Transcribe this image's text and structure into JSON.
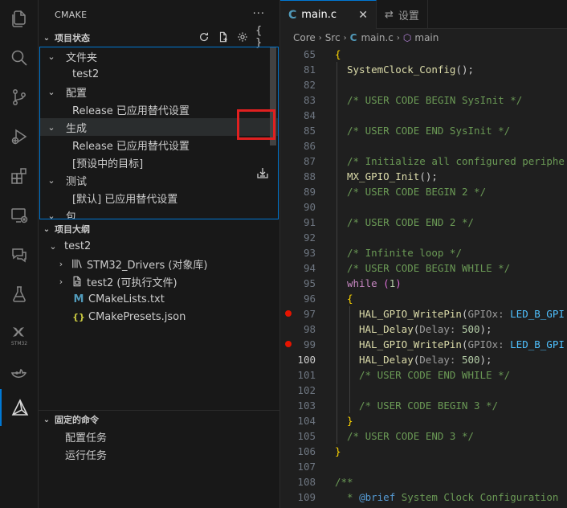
{
  "sidebar": {
    "title": "CMAKE",
    "more": "···",
    "project_status": {
      "title": "项目状态",
      "rows": [
        {
          "label": "文件夹",
          "kind": "group"
        },
        {
          "label": "test2",
          "kind": "leaf"
        },
        {
          "label": "配置",
          "kind": "group"
        },
        {
          "label": "Release  已应用替代设置",
          "kind": "leaf"
        },
        {
          "label": "生成",
          "kind": "group"
        },
        {
          "label": "Release  已应用替代设置",
          "kind": "leaf"
        },
        {
          "label": "[预设中的目标]",
          "kind": "leaf"
        },
        {
          "label": "测试",
          "kind": "group"
        },
        {
          "label": "[默认]  已应用替代设置",
          "kind": "leaf"
        },
        {
          "label": "包",
          "kind": "group"
        }
      ]
    },
    "project_outline": {
      "title": "项目大纲",
      "root": "test2",
      "items": [
        {
          "label": "STM32_Drivers (对象库)",
          "icon": "library-icon"
        },
        {
          "label": "test2 (可执行文件)",
          "icon": "executable-icon"
        },
        {
          "label": "CMakeLists.txt",
          "icon": "cmake-file-icon",
          "glyph": "M"
        },
        {
          "label": "CMakePresets.json",
          "icon": "json-file-icon",
          "glyph": "{}"
        }
      ]
    },
    "pinned_commands": {
      "title": "固定的命令",
      "items": [
        "配置任务",
        "运行任务"
      ]
    }
  },
  "activity_bar": {
    "items": [
      "explorer-icon",
      "search-icon",
      "source-control-icon",
      "run-debug-icon",
      "extensions-icon",
      "remote-explorer-icon",
      "chat-icon",
      "testing-icon",
      "stm32-icon",
      "docker-icon",
      "cmake-icon"
    ],
    "stm32_label": "STM32"
  },
  "editor": {
    "tabs": [
      {
        "label": "main.c",
        "icon": "C",
        "active": true
      },
      {
        "label": "设置",
        "icon": "settings-icon",
        "active": false
      }
    ],
    "breadcrumb": [
      "Core",
      "Src",
      "main.c",
      "main"
    ],
    "current_line": "100",
    "lines": [
      {
        "n": "65",
        "text": "{"
      },
      {
        "n": "81",
        "text": "SystemClock_Config();"
      },
      {
        "n": "82",
        "text": ""
      },
      {
        "n": "83",
        "text": "/* USER CODE BEGIN SysInit */"
      },
      {
        "n": "84",
        "text": ""
      },
      {
        "n": "85",
        "text": "/* USER CODE END SysInit */"
      },
      {
        "n": "86",
        "text": ""
      },
      {
        "n": "87",
        "text": "/* Initialize all configured periphe"
      },
      {
        "n": "88",
        "text": "MX_GPIO_Init();"
      },
      {
        "n": "89",
        "text": "/* USER CODE BEGIN 2 */"
      },
      {
        "n": "90",
        "text": ""
      },
      {
        "n": "91",
        "text": "/* USER CODE END 2 */"
      },
      {
        "n": "92",
        "text": ""
      },
      {
        "n": "93",
        "text": "/* Infinite loop */"
      },
      {
        "n": "94",
        "text": "/* USER CODE BEGIN WHILE */"
      },
      {
        "n": "95",
        "text": "while (1)"
      },
      {
        "n": "96",
        "text": "{"
      },
      {
        "n": "97",
        "text": "HAL_GPIO_WritePin(GPIOx: LED_B_GPI"
      },
      {
        "n": "98",
        "text": "HAL_Delay(Delay: 500);"
      },
      {
        "n": "99",
        "text": "HAL_GPIO_WritePin(GPIOx: LED_B_GPI"
      },
      {
        "n": "100",
        "text": "HAL_Delay(Delay: 500);"
      },
      {
        "n": "101",
        "text": "/* USER CODE END WHILE */"
      },
      {
        "n": "102",
        "text": ""
      },
      {
        "n": "103",
        "text": "/* USER CODE BEGIN 3 */"
      },
      {
        "n": "104",
        "text": "}"
      },
      {
        "n": "105",
        "text": "/* USER CODE END 3 */"
      },
      {
        "n": "106",
        "text": "}"
      },
      {
        "n": "107",
        "text": ""
      },
      {
        "n": "108",
        "text": "/**"
      },
      {
        "n": "109",
        "text": "* @brief System Clock Configuration"
      }
    ],
    "breakpoints": [
      "97",
      "99"
    ]
  },
  "colors": {
    "accent": "#0078d4",
    "highlight_box": "#e02020",
    "breakpoint": "#e51400"
  }
}
